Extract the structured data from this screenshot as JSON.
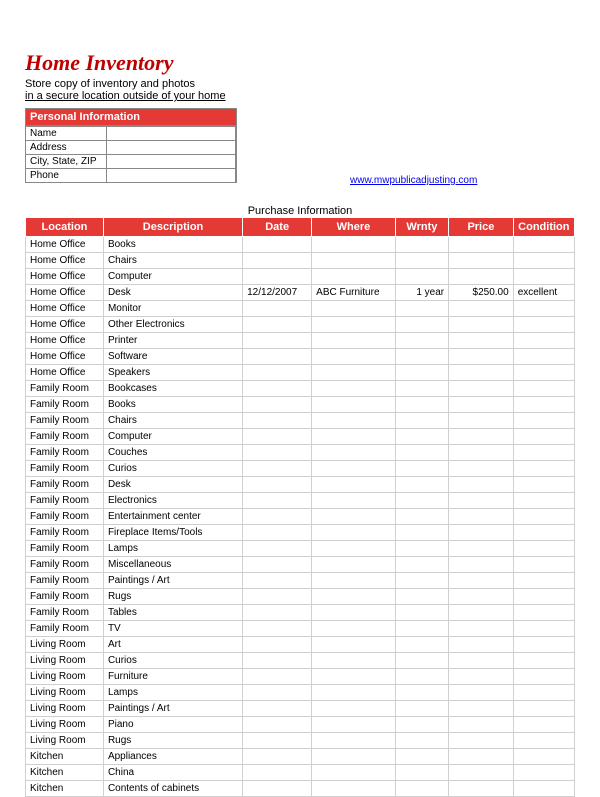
{
  "title": "Home Inventory",
  "subtitle_line1": "Store copy of inventory and photos",
  "subtitle_line2": "in a secure location outside of your home",
  "personal_info": {
    "header": "Personal Information",
    "labels": {
      "name": "Name",
      "address": "Address",
      "csz": "City, State, ZIP",
      "phone": "Phone"
    },
    "values": {
      "name": "",
      "address": "",
      "csz": "",
      "phone": ""
    }
  },
  "link": {
    "text": "www.mwpublicadjusting.com",
    "href": "#"
  },
  "purchase_header": "Purchase Information",
  "columns": {
    "location": "Location",
    "description": "Description",
    "date": "Date",
    "where": "Where",
    "wrnty": "Wrnty",
    "price": "Price",
    "condition": "Condition"
  },
  "rows": [
    {
      "loc": "Home Office",
      "desc": "Books",
      "date": "",
      "where": "",
      "wrnty": "",
      "price": "",
      "cond": ""
    },
    {
      "loc": "Home Office",
      "desc": "Chairs",
      "date": "",
      "where": "",
      "wrnty": "",
      "price": "",
      "cond": ""
    },
    {
      "loc": "Home Office",
      "desc": "Computer",
      "date": "",
      "where": "",
      "wrnty": "",
      "price": "",
      "cond": ""
    },
    {
      "loc": "Home Office",
      "desc": "Desk",
      "date": "12/12/2007",
      "where": "ABC Furniture",
      "wrnty": "1 year",
      "price": "$250.00",
      "cond": "excellent"
    },
    {
      "loc": "Home Office",
      "desc": "Monitor",
      "date": "",
      "where": "",
      "wrnty": "",
      "price": "",
      "cond": ""
    },
    {
      "loc": "Home Office",
      "desc": "Other Electronics",
      "date": "",
      "where": "",
      "wrnty": "",
      "price": "",
      "cond": ""
    },
    {
      "loc": "Home Office",
      "desc": "Printer",
      "date": "",
      "where": "",
      "wrnty": "",
      "price": "",
      "cond": ""
    },
    {
      "loc": "Home Office",
      "desc": "Software",
      "date": "",
      "where": "",
      "wrnty": "",
      "price": "",
      "cond": ""
    },
    {
      "loc": "Home Office",
      "desc": "Speakers",
      "date": "",
      "where": "",
      "wrnty": "",
      "price": "",
      "cond": ""
    },
    {
      "loc": "Family Room",
      "desc": "Bookcases",
      "date": "",
      "where": "",
      "wrnty": "",
      "price": "",
      "cond": ""
    },
    {
      "loc": "Family Room",
      "desc": "Books",
      "date": "",
      "where": "",
      "wrnty": "",
      "price": "",
      "cond": ""
    },
    {
      "loc": "Family Room",
      "desc": "Chairs",
      "date": "",
      "where": "",
      "wrnty": "",
      "price": "",
      "cond": ""
    },
    {
      "loc": "Family Room",
      "desc": "Computer",
      "date": "",
      "where": "",
      "wrnty": "",
      "price": "",
      "cond": ""
    },
    {
      "loc": "Family Room",
      "desc": "Couches",
      "date": "",
      "where": "",
      "wrnty": "",
      "price": "",
      "cond": ""
    },
    {
      "loc": "Family Room",
      "desc": "Curios",
      "date": "",
      "where": "",
      "wrnty": "",
      "price": "",
      "cond": ""
    },
    {
      "loc": "Family Room",
      "desc": "Desk",
      "date": "",
      "where": "",
      "wrnty": "",
      "price": "",
      "cond": ""
    },
    {
      "loc": "Family Room",
      "desc": "Electronics",
      "date": "",
      "where": "",
      "wrnty": "",
      "price": "",
      "cond": ""
    },
    {
      "loc": "Family Room",
      "desc": "Entertainment center",
      "date": "",
      "where": "",
      "wrnty": "",
      "price": "",
      "cond": ""
    },
    {
      "loc": "Family Room",
      "desc": "Fireplace Items/Tools",
      "date": "",
      "where": "",
      "wrnty": "",
      "price": "",
      "cond": ""
    },
    {
      "loc": "Family Room",
      "desc": "Lamps",
      "date": "",
      "where": "",
      "wrnty": "",
      "price": "",
      "cond": ""
    },
    {
      "loc": "Family Room",
      "desc": "Miscellaneous",
      "date": "",
      "where": "",
      "wrnty": "",
      "price": "",
      "cond": ""
    },
    {
      "loc": "Family Room",
      "desc": "Paintings / Art",
      "date": "",
      "where": "",
      "wrnty": "",
      "price": "",
      "cond": ""
    },
    {
      "loc": "Family Room",
      "desc": "Rugs",
      "date": "",
      "where": "",
      "wrnty": "",
      "price": "",
      "cond": ""
    },
    {
      "loc": "Family Room",
      "desc": "Tables",
      "date": "",
      "where": "",
      "wrnty": "",
      "price": "",
      "cond": ""
    },
    {
      "loc": "Family Room",
      "desc": "TV",
      "date": "",
      "where": "",
      "wrnty": "",
      "price": "",
      "cond": ""
    },
    {
      "loc": "Living Room",
      "desc": "Art",
      "date": "",
      "where": "",
      "wrnty": "",
      "price": "",
      "cond": ""
    },
    {
      "loc": "Living Room",
      "desc": "Curios",
      "date": "",
      "where": "",
      "wrnty": "",
      "price": "",
      "cond": ""
    },
    {
      "loc": "Living Room",
      "desc": "Furniture",
      "date": "",
      "where": "",
      "wrnty": "",
      "price": "",
      "cond": ""
    },
    {
      "loc": "Living Room",
      "desc": "Lamps",
      "date": "",
      "where": "",
      "wrnty": "",
      "price": "",
      "cond": ""
    },
    {
      "loc": "Living Room",
      "desc": "Paintings / Art",
      "date": "",
      "where": "",
      "wrnty": "",
      "price": "",
      "cond": ""
    },
    {
      "loc": "Living Room",
      "desc": "Piano",
      "date": "",
      "where": "",
      "wrnty": "",
      "price": "",
      "cond": ""
    },
    {
      "loc": "Living Room",
      "desc": "Rugs",
      "date": "",
      "where": "",
      "wrnty": "",
      "price": "",
      "cond": ""
    },
    {
      "loc": "Kitchen",
      "desc": "Appliances",
      "date": "",
      "where": "",
      "wrnty": "",
      "price": "",
      "cond": ""
    },
    {
      "loc": "Kitchen",
      "desc": "China",
      "date": "",
      "where": "",
      "wrnty": "",
      "price": "",
      "cond": ""
    },
    {
      "loc": "Kitchen",
      "desc": "Contents of cabinets",
      "date": "",
      "where": "",
      "wrnty": "",
      "price": "",
      "cond": ""
    }
  ]
}
